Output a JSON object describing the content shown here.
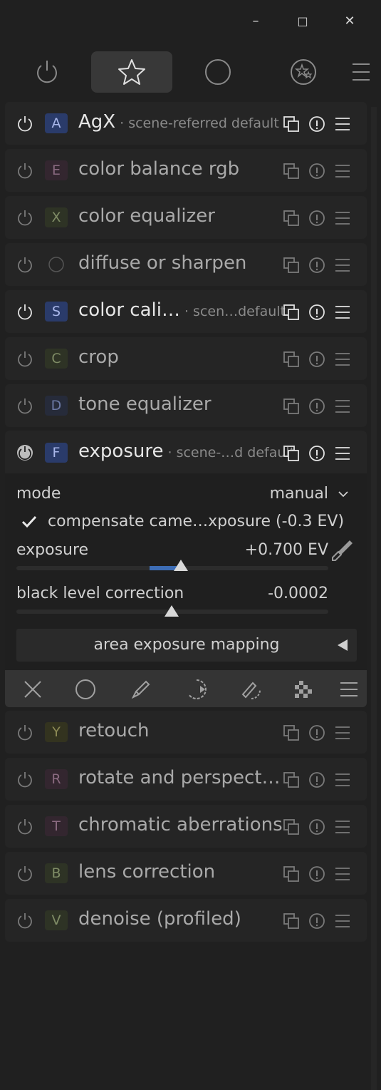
{
  "window": {
    "minimize_glyph": "–",
    "maximize_glyph": "□",
    "close_glyph": "✕"
  },
  "tabs": [
    {
      "icon": "power-icon",
      "label": ""
    },
    {
      "icon": "star-icon",
      "label": "",
      "active": true
    },
    {
      "icon": "circle-icon",
      "label": ""
    },
    {
      "icon": "presets-icon",
      "label": ""
    },
    {
      "icon": "hamburger-menu-icon",
      "label": ""
    }
  ],
  "modules_top": [
    {
      "letter": "A",
      "name": "AgX",
      "sub": "· scene-referred default",
      "badge_color": "#2a3b6a",
      "letter_color": "#a9b7ea",
      "active": true
    },
    {
      "letter": "E",
      "name": "color balance rgb",
      "sub": "",
      "badge_color": "#33262f",
      "letter_color": "#8a6a80",
      "active": false
    },
    {
      "letter": "X",
      "name": "color equalizer",
      "sub": "",
      "badge_color": "#2e3325",
      "letter_color": "#7f8c66",
      "active": false
    },
    {
      "letter": "",
      "name": "diffuse or sharpen",
      "sub": "",
      "badge_color": "transparent",
      "letter_color": "#777",
      "active": false
    },
    {
      "letter": "S",
      "name": "color cali…",
      "sub": "· scen…default",
      "badge_color": "#2a3b6a",
      "letter_color": "#a9b7ea",
      "active": true
    },
    {
      "letter": "C",
      "name": "crop",
      "sub": "",
      "badge_color": "#2e3325",
      "letter_color": "#7f8c66",
      "active": false
    },
    {
      "letter": "D",
      "name": "tone equalizer",
      "sub": "",
      "badge_color": "#262b3a",
      "letter_color": "#6d7ba6",
      "active": false
    },
    {
      "letter": "F",
      "name": "exposure",
      "sub": "· scene-…d default",
      "badge_color": "#2a3b6a",
      "letter_color": "#a9b7ea",
      "active": true
    }
  ],
  "exposure": {
    "mode_label": "mode",
    "mode_value": "manual",
    "compensate_label": "compensate came…xposure (-0.3 EV)",
    "compensate_checked": true,
    "exposure_label": "exposure",
    "exposure_value": "+0.700 EV",
    "black_label": "black level correction",
    "black_value": "-0.0002",
    "area_label": "area exposure mapping"
  },
  "toolbar_icons": [
    "close-icon",
    "circle-mask-icon",
    "pencil-icon",
    "parametric-mask-icon",
    "drawn-parametric-mask-icon",
    "raster-mask-icon",
    "menu-icon"
  ],
  "modules_bottom": [
    {
      "letter": "Y",
      "name": "retouch",
      "sub": "",
      "badge_color": "#33331f",
      "letter_color": "#8c8a55",
      "active": false
    },
    {
      "letter": "R",
      "name": "rotate and perspect…",
      "sub": "",
      "badge_color": "#33262f",
      "letter_color": "#8a6a80",
      "active": false
    },
    {
      "letter": "T",
      "name": "chromatic aberrations",
      "sub": "",
      "badge_color": "#33262f",
      "letter_color": "#8a6a80",
      "active": false
    },
    {
      "letter": "B",
      "name": "lens correction",
      "sub": "",
      "badge_color": "#2e3325",
      "letter_color": "#7f8c66",
      "active": false
    },
    {
      "letter": "V",
      "name": "denoise (profiled)",
      "sub": "",
      "badge_color": "#2e3325",
      "letter_color": "#7f8c66",
      "active": false
    }
  ]
}
